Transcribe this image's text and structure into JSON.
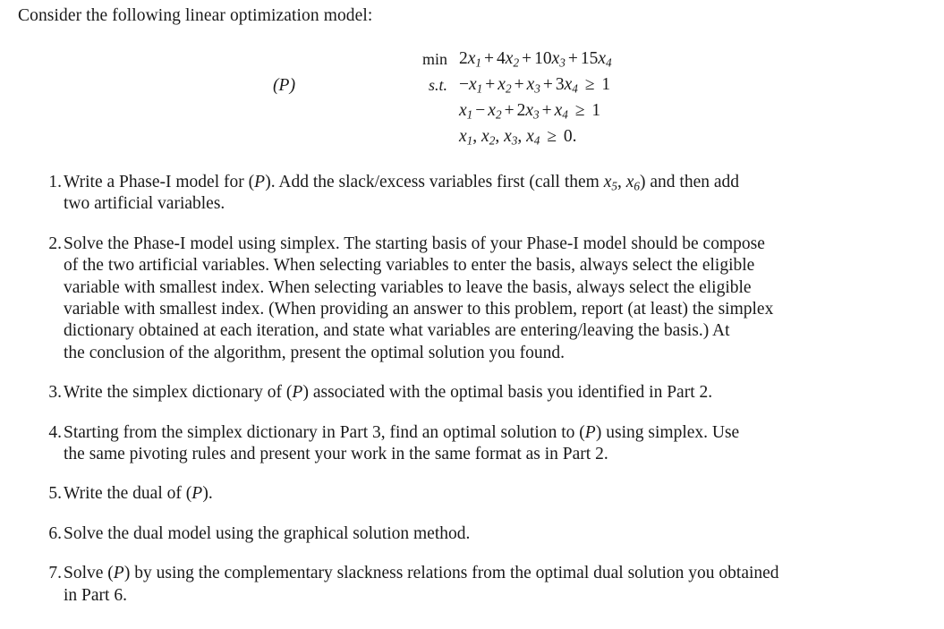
{
  "document": {
    "intro": "Consider the following linear optimization model:",
    "model": {
      "tag": "(P)",
      "rows": [
        {
          "op": "min",
          "op_italic": false,
          "expr_plain": "2x1 + 4x2 + 10x3 + 15x4"
        },
        {
          "op": "s.t.",
          "op_italic": true,
          "expr_plain": "-x1 + x2 + x3 + 3x4 >= 1"
        },
        {
          "op": "",
          "op_italic": false,
          "expr_plain": "x1 - x2 + 2x3 + x4 >= 1"
        },
        {
          "op": "",
          "op_italic": false,
          "expr_plain": "x1, x2, x3, x4 >= 0."
        }
      ]
    },
    "items": [
      {
        "num": "1.",
        "lines": [
          "Write a Phase-I model for (P). Add the slack/excess variables first (call them x5, x6) and then add",
          "two artificial variables."
        ]
      },
      {
        "num": "2.",
        "lines": [
          "Solve the Phase-I model using simplex. The starting basis of your Phase-I model should be compose",
          "of the two artificial variables. When selecting variables to enter the basis, always select the eligible",
          "variable with smallest index. When selecting variables to leave the basis, always select the eligible",
          "variable with smallest index. (When providing an answer to this problem, report (at least) the simplex",
          "dictionary obtained at each iteration, and state what variables are entering/leaving the basis.) At",
          "the conclusion of the algorithm, present the optimal solution you found."
        ]
      },
      {
        "num": "3.",
        "lines": [
          "Write the simplex dictionary of (P) associated with the optimal basis you identified in Part 2."
        ]
      },
      {
        "num": "4.",
        "lines": [
          "Starting from the simplex dictionary in Part 3, find an optimal solution to (P) using simplex. Use",
          "the same pivoting rules and present your work in the same format as in Part 2."
        ]
      },
      {
        "num": "5.",
        "lines": [
          "Write the dual of (P)."
        ]
      },
      {
        "num": "6.",
        "lines": [
          "Solve the dual model using the graphical solution method."
        ]
      },
      {
        "num": "7.",
        "lines": [
          "Solve (P) by using the complementary slackness relations from the optimal dual solution you obtained",
          "in Part 6."
        ]
      }
    ]
  }
}
